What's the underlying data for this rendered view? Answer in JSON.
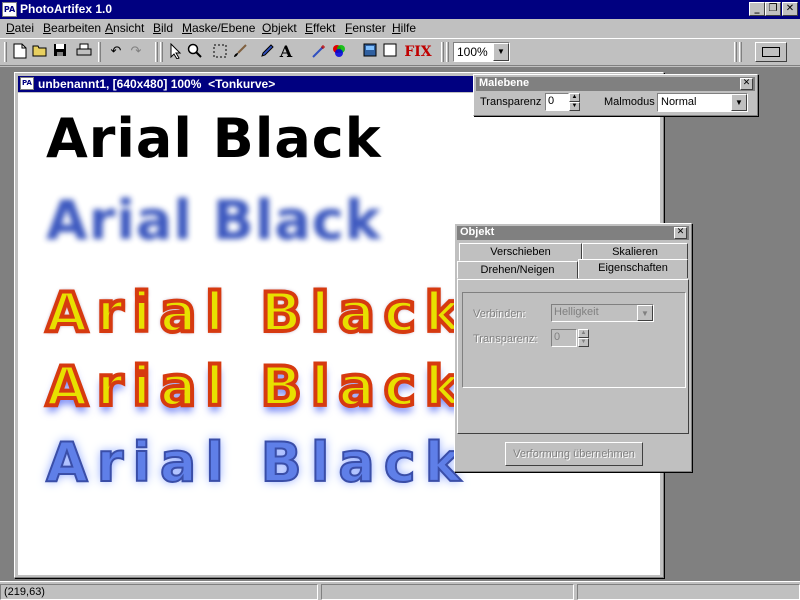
{
  "app": {
    "title": "PhotoArtifex 1.0",
    "icon_text": "PA"
  },
  "window_controls": {
    "minimize": "_",
    "restore": "❐",
    "close": "✕"
  },
  "menu": [
    "Datei",
    "Bearbeiten",
    "Ansicht",
    "Bild",
    "Maske/Ebene",
    "Objekt",
    "Effekt",
    "Fenster",
    "Hilfe"
  ],
  "toolbar": {
    "icons": [
      "new-file-icon",
      "open-folder-icon",
      "save-disk-icon",
      "print-icon",
      "undo-icon",
      "redo-icon",
      "select-arrow-icon",
      "zoom-tool-icon",
      "marquee-select-icon",
      "brush-icon",
      "eyedropper-icon",
      "text-tool-icon",
      "wand-icon",
      "color-wheel-icon",
      "layer-icon",
      "blank-layer-icon"
    ],
    "fix_label": "FIX",
    "text_tool_label": "A",
    "zoom_value": "100%"
  },
  "document": {
    "title": "unbenannt1, [640x480] 100%  <Tonkurve>",
    "artworks": [
      "Arial Black",
      "Arial Black",
      "Arial Black",
      "Arial Black",
      "Arial Black"
    ]
  },
  "malebene": {
    "title": "Malebene",
    "close": "✕",
    "transparency_label": "Transparenz",
    "transparency_value": "0",
    "mode_label": "Malmodus",
    "mode_value": "Normal"
  },
  "objekt": {
    "title": "Objekt",
    "close": "✕",
    "tabs": [
      "Verschieben",
      "Skalieren",
      "Drehen/Neigen",
      "Eigenschaften"
    ],
    "active_tab": "Eigenschaften",
    "combine_label": "Verbinden:",
    "combine_value": "Helligkeit",
    "transparency_label": "Transparenz:",
    "transparency_value": "0",
    "apply_button": "Verformung übernehmen"
  },
  "statusbar": {
    "coords": "(219,63)"
  },
  "colors": {
    "titlebar": "#000080",
    "face": "#c0c0c0",
    "workspace": "#808080",
    "fix_red": "#c00000"
  }
}
